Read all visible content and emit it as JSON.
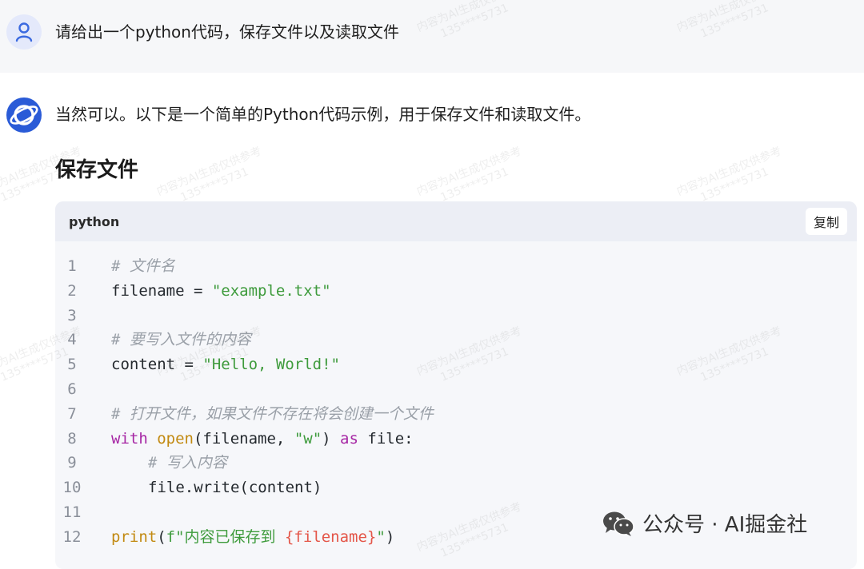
{
  "user_message": {
    "text": "请给出一个python代码，保存文件以及读取文件"
  },
  "assistant_message": {
    "intro": "当然可以。以下是一个简单的Python代码示例，用于保存文件和读取文件。",
    "section_heading": "保存文件"
  },
  "code_block": {
    "language": "python",
    "copy_label": "复制",
    "lines": [
      {
        "n": "1",
        "indent": false,
        "tokens": [
          {
            "t": "comment",
            "v": "# 文件名"
          }
        ]
      },
      {
        "n": "2",
        "indent": false,
        "tokens": [
          {
            "t": "plain",
            "v": "filename = "
          },
          {
            "t": "string",
            "v": "\"example.txt\""
          }
        ]
      },
      {
        "n": "3",
        "indent": false,
        "tokens": []
      },
      {
        "n": "4",
        "indent": false,
        "tokens": [
          {
            "t": "comment",
            "v": "# 要写入文件的内容"
          }
        ]
      },
      {
        "n": "5",
        "indent": false,
        "tokens": [
          {
            "t": "plain",
            "v": "content = "
          },
          {
            "t": "string",
            "v": "\"Hello, World!\""
          }
        ]
      },
      {
        "n": "6",
        "indent": false,
        "tokens": []
      },
      {
        "n": "7",
        "indent": false,
        "tokens": [
          {
            "t": "comment",
            "v": "# 打开文件，如果文件不存在将会创建一个文件"
          }
        ]
      },
      {
        "n": "8",
        "indent": false,
        "tokens": [
          {
            "t": "kw",
            "v": "with"
          },
          {
            "t": "plain",
            "v": " "
          },
          {
            "t": "fn",
            "v": "open"
          },
          {
            "t": "plain",
            "v": "(filename, "
          },
          {
            "t": "string",
            "v": "\"w\""
          },
          {
            "t": "plain",
            "v": ") "
          },
          {
            "t": "kw",
            "v": "as"
          },
          {
            "t": "plain",
            "v": " file:"
          }
        ]
      },
      {
        "n": "9",
        "indent": true,
        "tokens": [
          {
            "t": "comment",
            "v": "# 写入内容"
          }
        ]
      },
      {
        "n": "10",
        "indent": true,
        "tokens": [
          {
            "t": "plain",
            "v": "file.write(content)"
          }
        ]
      },
      {
        "n": "11",
        "indent": false,
        "tokens": []
      },
      {
        "n": "12",
        "indent": false,
        "tokens": [
          {
            "t": "fn",
            "v": "print"
          },
          {
            "t": "plain",
            "v": "("
          },
          {
            "t": "string",
            "v": "f\"内容已保存到 "
          },
          {
            "t": "interp",
            "v": "{filename}"
          },
          {
            "t": "string",
            "v": "\""
          },
          {
            "t": "plain",
            "v": ")"
          }
        ]
      }
    ]
  },
  "watermark": {
    "line1": "内容为AI生成仅供参考",
    "line2": "135****5731"
  },
  "source_mark": {
    "text": "公众号 · AI掘金社",
    "icon": "wechat-icon"
  },
  "colors": {
    "accent": "#2a5bd7",
    "string": "#3e9b3c",
    "keyword": "#a626a4",
    "function": "#c28a12",
    "comment": "#9aa0a8"
  }
}
